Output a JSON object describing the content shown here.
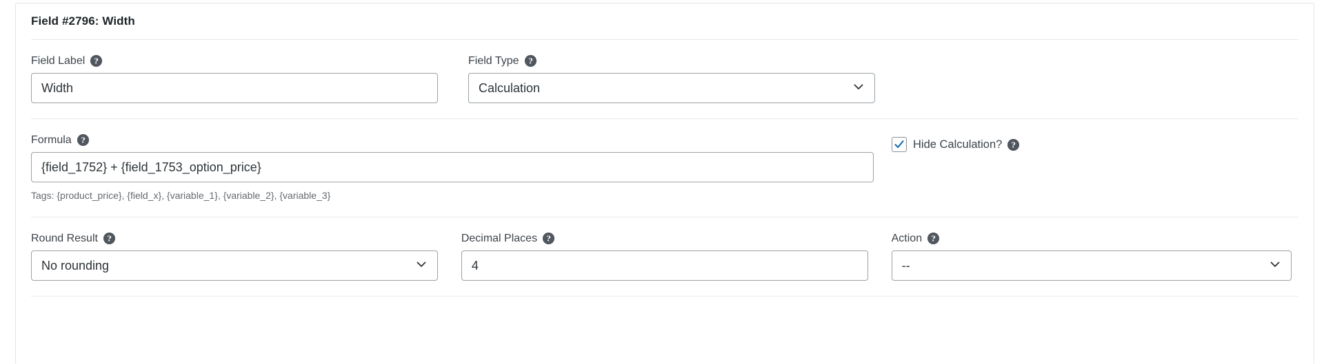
{
  "panel": {
    "title": "Field #2796: Width"
  },
  "colors": {
    "accent_checkmark": "#2271b1",
    "help_icon_bg": "#50575e",
    "border": "#9ba1a6",
    "panel_border": "#e2e4e7",
    "text": "#2c3338",
    "label_text": "#3c434a",
    "hint_text": "#646970"
  },
  "fields": {
    "field_label": {
      "label": "Field Label",
      "value": "Width",
      "help_icon": "question-mark-circle-icon"
    },
    "field_type": {
      "label": "Field Type",
      "value": "Calculation",
      "help_icon": "question-mark-circle-icon",
      "chevron_icon": "chevron-down-icon"
    },
    "formula": {
      "label": "Formula",
      "value": "{field_1752} + {field_1753_option_price}",
      "help_icon": "question-mark-circle-icon",
      "tags_hint": "Tags: {product_price}, {field_x}, {variable_1}, {variable_2}, {variable_3}"
    },
    "hide_calculation": {
      "label": "Hide Calculation?",
      "checked": true,
      "check_icon": "checkmark-icon",
      "help_icon": "question-mark-circle-icon"
    },
    "round_result": {
      "label": "Round Result",
      "value": "No rounding",
      "help_icon": "question-mark-circle-icon",
      "chevron_icon": "chevron-down-icon"
    },
    "decimal_places": {
      "label": "Decimal Places",
      "value": "4",
      "help_icon": "question-mark-circle-icon"
    },
    "action": {
      "label": "Action",
      "value": "--",
      "help_icon": "question-mark-circle-icon",
      "chevron_icon": "chevron-down-icon"
    }
  }
}
